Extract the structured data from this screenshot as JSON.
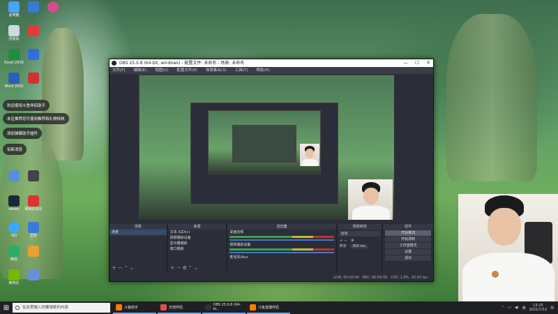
{
  "desktop": {
    "icons": [
      {
        "label": "此电脑",
        "color": "#4aa3ff"
      },
      {
        "label": "回收站",
        "color": "#cfd8e3"
      },
      {
        "label": "Excel 2016",
        "color": "#1e8e3e"
      },
      {
        "label": "Word 2016",
        "color": "#2b5fb8"
      },
      {
        "label": "steam",
        "color": "#1b2838"
      },
      {
        "label": "网易云音乐",
        "color": "#d33"
      },
      {
        "label": "QQ",
        "color": "#38a9ff"
      },
      {
        "label": "迅雷",
        "color": "#3a7bd5"
      },
      {
        "label": "微信",
        "color": "#2aae67"
      },
      {
        "label": "英伟达",
        "color": "#76b900"
      }
    ],
    "notifications": [
      "欢迎使用斗鱼伴侣助手",
      "本区推荐您可使用推荐和礼物特效",
      "添加弹幕助手插件",
      "有新消息"
    ]
  },
  "obs": {
    "title": "OBS 25.0.8 (64-bit, windows) - 配置文件: 未命名 - 场景: 未命名",
    "menu": [
      "文件(F)",
      "编辑(E)",
      "视图(V)",
      "配置文件(P)",
      "场景集合(S)",
      "工具(T)",
      "帮助(H)"
    ],
    "window_buttons": [
      "—",
      "☐",
      "✕"
    ],
    "docks": {
      "scenes": {
        "title": "场景",
        "items": [
          "场景"
        ]
      },
      "sources": {
        "title": "来源",
        "items": [
          "文本 (GDI+)",
          "视频捕获设备",
          "显示器捕获",
          "窗口捕获"
        ]
      },
      "mixer": {
        "title": "混音器",
        "channels": [
          {
            "name": "桌面音频",
            "db": "0.0 dB"
          },
          {
            "name": "视频捕获设备",
            "db": "0.0 dB"
          },
          {
            "name": "麦克风/Aux",
            "db": "0.0 dB"
          }
        ]
      },
      "transitions": {
        "title": "场景转场",
        "type": "淡出",
        "duration_label": "时长",
        "duration": "300 ms"
      },
      "controls": {
        "title": "控件",
        "buttons": [
          "开始推流",
          "开始录制",
          "工作室模式",
          "设置",
          "退出"
        ]
      }
    },
    "status": {
      "live": "LIVE: 00:00:00",
      "rec": "REC: 00:00:00",
      "cpu": "CPU: 1.8%, 30.00 fps"
    }
  },
  "taskbar": {
    "search_placeholder": "在这里输入你要搜索的内容",
    "apps": [
      {
        "label": "斗鱼助手",
        "color": "#ff7a00"
      },
      {
        "label": "无他伴侣",
        "color": "#e84b4b"
      },
      {
        "label": "OBS 25.0.8 (64-bi...",
        "color": "#333"
      },
      {
        "label": "斗鱼直播伴侣",
        "color": "#ff7a00"
      }
    ],
    "language": "英",
    "time": "13:25",
    "date": "2021/7/12"
  }
}
